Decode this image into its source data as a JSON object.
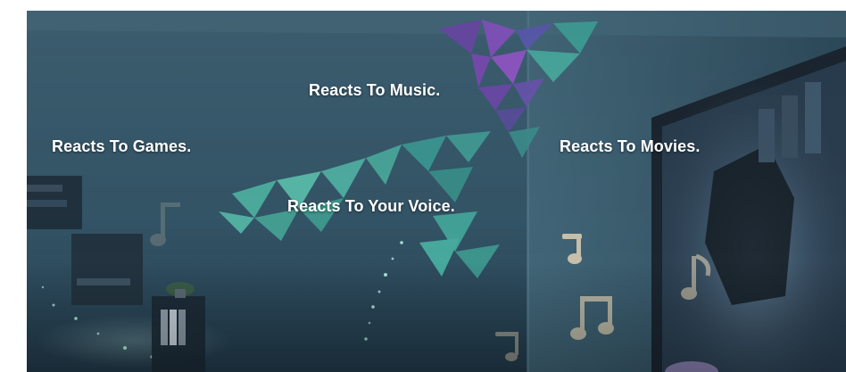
{
  "hero": {
    "captions": {
      "music": "Reacts To Music.",
      "games": "Reacts To Games.",
      "movies": "Reacts To Movies.",
      "voice": "Reacts To Your Voice."
    },
    "palette": {
      "wall": "#3a5d70",
      "wall_dark": "#24394a",
      "panel_purple": "#7a4fb0",
      "panel_violet": "#5c4ea0",
      "panel_teal": "#3fa39a",
      "panel_mint": "#5cc0ad",
      "glow": "#b9f1e6",
      "note": "#e9d7b8"
    }
  }
}
